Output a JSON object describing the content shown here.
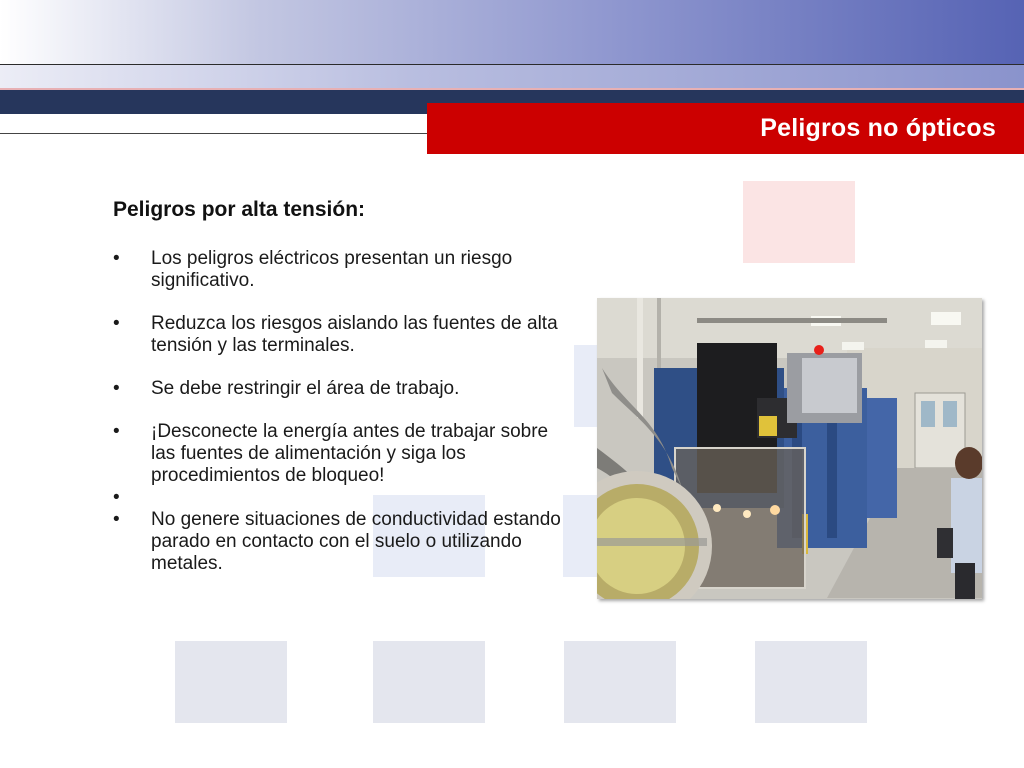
{
  "slide": {
    "title": "Peligros no ópticos",
    "subtitle": "Peligros por alta tensión:",
    "bullets": [
      "Los peligros eléctricos presentan un riesgo significativo.",
      "Reduzca los riesgos aislando las fuentes de alta tensión y las terminales.",
      "Se debe restringir el área de trabajo.",
      "¡Desconecte la energía antes de trabajar sobre las fuentes de alimentación y siga los procedimientos de bloqueo!",
      "",
      "No genere situaciones de conductividad estando parado en contacto con el suelo o utilizando metales."
    ]
  },
  "colors": {
    "title_bar": "#cc0000",
    "navy_band": "#26365c",
    "gradient_end": "#5663b4",
    "square_pink": "#fbe4e4",
    "square_grey": "#e4e6ee"
  },
  "photo": {
    "subject": "laser-laboratory-equipment"
  }
}
